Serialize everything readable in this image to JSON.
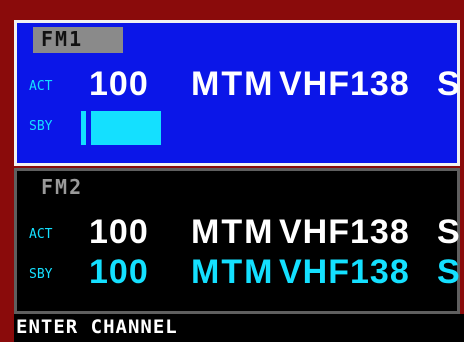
{
  "colors": {
    "frame": "#8a0b0b",
    "fm1_background": "#0b16e8",
    "fm1_border": "#f2f2f2",
    "fm2_background": "#000000",
    "fm2_border": "#5f5f5f",
    "header_chip": "#8a8a8a",
    "text_white": "#ffffff",
    "text_cyan": "#14e0ff",
    "entry_highlight": "#14e0ff"
  },
  "fm1": {
    "title": "FM1",
    "active": {
      "label": "ACT",
      "channel": "100",
      "mode": "MTM",
      "band": "VHF138",
      "suffix": "S"
    },
    "standby": {
      "label": "SBY",
      "entry_value": ""
    }
  },
  "fm2": {
    "title": "FM2",
    "active": {
      "label": "ACT",
      "channel": "100",
      "mode": "MTM",
      "band": "VHF138",
      "suffix": "S"
    },
    "standby": {
      "label": "SBY",
      "channel": "100",
      "mode": "MTM",
      "band": "VHF138",
      "suffix": "S"
    }
  },
  "status": {
    "prompt": "ENTER CHANNEL"
  }
}
